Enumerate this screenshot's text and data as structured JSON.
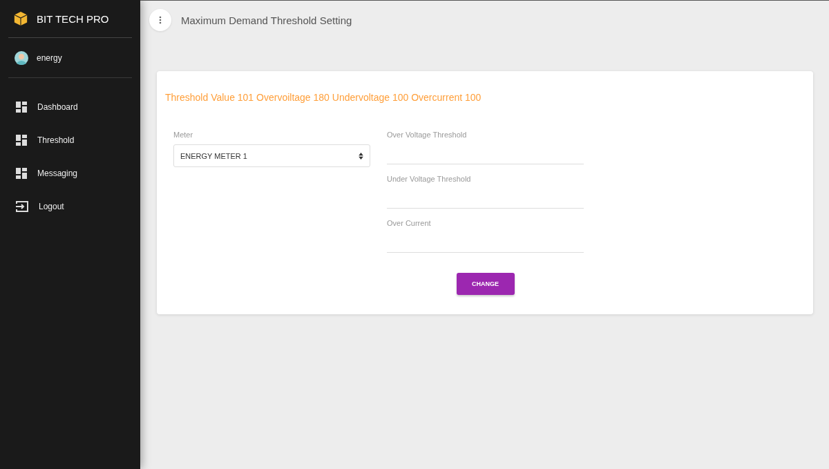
{
  "sidebar": {
    "brand": "BIT TECH PRO",
    "user": "energy",
    "items": [
      {
        "label": "Dashboard",
        "kind": "grid"
      },
      {
        "label": "Threshold",
        "kind": "grid"
      },
      {
        "label": "Messaging",
        "kind": "grid"
      },
      {
        "label": "Logout",
        "kind": "logout"
      }
    ]
  },
  "header": {
    "title": "Maximum Demand Threshold Setting"
  },
  "card": {
    "summary": "Threshold Value 101 Overvoiltage 180 Undervoltage 100 Overcurrent 100",
    "meter": {
      "label": "Meter",
      "value": "ENERGY METER 1"
    },
    "fields": [
      {
        "label": "Over Voltage Threshold"
      },
      {
        "label": "Under Voltage Threshold"
      },
      {
        "label": "Over Current"
      }
    ],
    "button": "CHANGE"
  }
}
